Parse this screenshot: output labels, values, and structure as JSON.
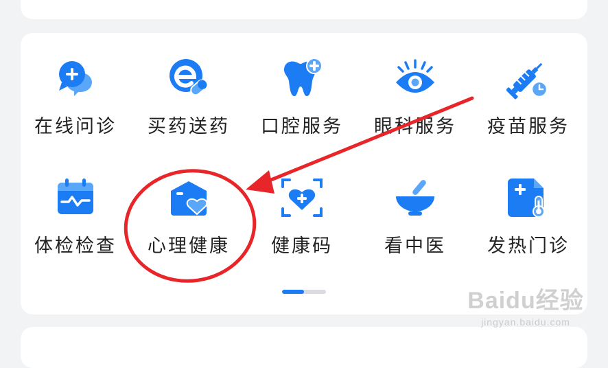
{
  "services": {
    "items": [
      {
        "label": "在线问诊",
        "icon": "chat-plus-icon"
      },
      {
        "label": "买药送药",
        "icon": "pharmacy-e-pill-icon"
      },
      {
        "label": "口腔服务",
        "icon": "tooth-plus-icon"
      },
      {
        "label": "眼科服务",
        "icon": "eye-icon"
      },
      {
        "label": "疫苗服务",
        "icon": "syringe-clock-icon"
      },
      {
        "label": "体检检查",
        "icon": "calendar-pulse-icon"
      },
      {
        "label": "心理健康",
        "icon": "house-heart-icon"
      },
      {
        "label": "健康码",
        "icon": "heart-scan-icon"
      },
      {
        "label": "看中医",
        "icon": "mortar-pestle-icon"
      },
      {
        "label": "发热门诊",
        "icon": "thermometer-doc-icon"
      }
    ]
  },
  "pager": {
    "pages": 2,
    "current": 1
  },
  "colors": {
    "accent": "#1c7cf4",
    "annotation": "#e8262a"
  },
  "watermark": {
    "logo": "Baidu经验",
    "url": "jingyan.baidu.com"
  }
}
